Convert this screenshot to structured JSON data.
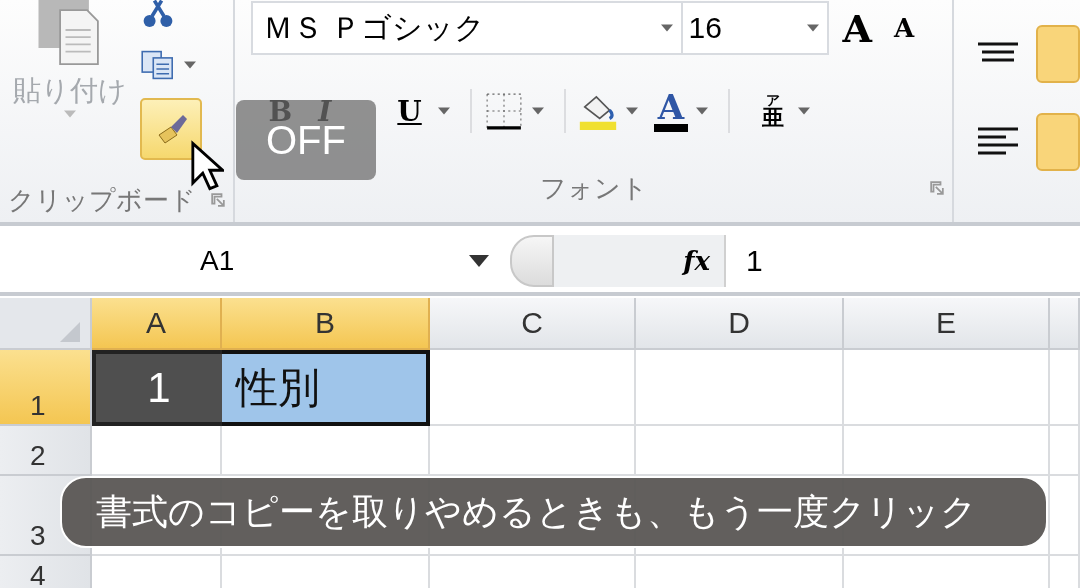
{
  "clipboard": {
    "paste_label": "貼り付け",
    "group_label": "クリップボード",
    "format_painter": {
      "on": true
    }
  },
  "font": {
    "name": "ＭＳ Ｐゴシック",
    "size": "16",
    "grow_glyph": "A",
    "shrink_glyph": "A",
    "style_buttons": [
      "B",
      "I",
      "U"
    ],
    "color_glyph": "A",
    "phonetic_glyphs": [
      "ア",
      "亜"
    ],
    "group_label": "フォント"
  },
  "toggle_badge": "OFF",
  "formula_bar": {
    "name_box": "A1",
    "function_glyph": "fx",
    "value": "1"
  },
  "columns": [
    {
      "label": "A",
      "selected": true
    },
    {
      "label": "B",
      "selected": true
    },
    {
      "label": "C",
      "selected": false
    },
    {
      "label": "D",
      "selected": false
    },
    {
      "label": "E",
      "selected": false
    }
  ],
  "rows": [
    {
      "label": "1",
      "selected": true,
      "cells": [
        {
          "text": "1",
          "kind": "shaded"
        },
        {
          "text": "性別",
          "kind": "highlighted"
        }
      ]
    },
    {
      "label": "2",
      "selected": false,
      "cells": []
    },
    {
      "label": "3",
      "selected": false,
      "cells": []
    },
    {
      "label": "4",
      "selected": false,
      "cells": []
    }
  ],
  "caption": "書式のコピーを取りやめるときも、もう一度クリック"
}
